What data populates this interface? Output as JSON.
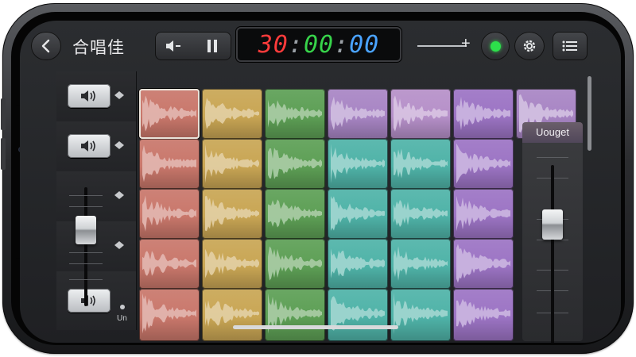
{
  "header": {
    "title": "合唱佳",
    "timer": {
      "d1": "30",
      "sep1": ":",
      "d2": "00",
      "sep2": ":",
      "d3": "00"
    },
    "back_icon": "chevron-left-icon",
    "speaker_icon": "speaker-icon",
    "pause_icon": "pause-icon",
    "record_color": "#2de04b"
  },
  "tracks": [
    {
      "type": "speaker",
      "icon": "speaker-icon"
    },
    {
      "type": "speaker",
      "icon": "speaker-icon"
    },
    {
      "type": "fader",
      "level": 0.55
    },
    {
      "type": "fader"
    },
    {
      "type": "speaker",
      "icon": "speaker-icon",
      "label": "Un"
    }
  ],
  "master": {
    "label": "Uouget",
    "level": 0.55
  },
  "grid": {
    "columns": [
      {
        "color": "#c9776b"
      },
      {
        "color": "#c9a654"
      },
      {
        "color": "#5d9f55"
      },
      {
        "color": "#a885c4"
      },
      {
        "color": "#b690c9"
      },
      {
        "color": "#9c74c4"
      }
    ],
    "column_colors_lower": [
      "#c9776b",
      "#c9a654",
      "#5d9f55",
      "#4fb3a8",
      "#4fb3a8",
      "#9c74c4"
    ],
    "rows": 5
  }
}
